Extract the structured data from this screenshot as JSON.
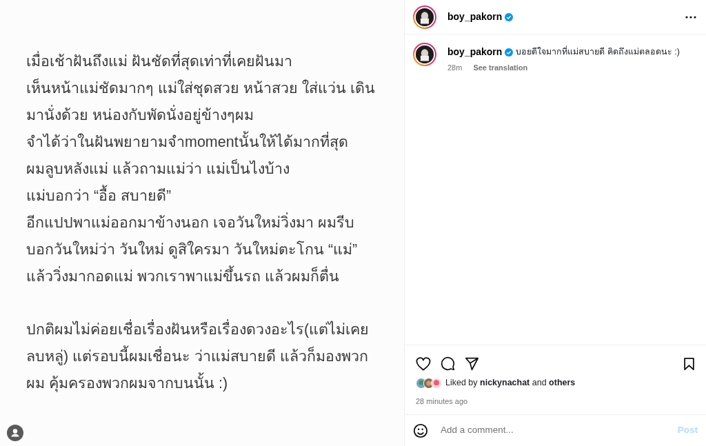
{
  "post_image": {
    "paragraphs": [
      [
        "เมื่อเช้าฝันถึงแม่ ฝันชัดที่สุดเท่าที่เคยฝันมา",
        "เห็นหน้าแม่ชัดมากๆ แม่ใส่ชุดสวย หน้าสวย ใส่แว่น เดิน",
        "มานั่งด้วย หน่องกับพัดนั่งอยู่ข้างๆผม",
        "จำได้ว่าในฝันพยายามจำmomentนั้นให้ได้มากที่สุด",
        "ผมลูบหลังแม่ แล้วถามแม่ว่า แม่เป็นไงบ้าง",
        "แม่บอกว่า “อื้อ สบายดี”",
        "อีกแปปพาแม่ออกมาข้างนอก เจอวันใหม่วิ่งมา ผมรีบ",
        "บอกวันใหม่ว่า วันใหม่ ดูสิใครมา วันใหม่ตะโกน “แม่”",
        "แล้ววิ่งมากอดแม่ พวกเราพาแม่ขึ้นรถ แล้วผมก็ตื่น"
      ],
      [
        "ปกติผมไม่ค่อยเชื่อเรื่องฝันหรือเรื่องดวงอะไร(แต่ไม่เคย",
        "ลบหลู่) แต่รอบนี้ผมเชื่อนะ ว่าแม่สบายดี แล้วก็มองพวก",
        "ผม คุ้มครองพวกผมจากบนนั้น :)"
      ]
    ]
  },
  "header": {
    "username": "boy_pakorn",
    "verified": true
  },
  "caption": {
    "username": "boy_pakorn",
    "verified": true,
    "text": "บอยดีใจมากที่แม่สบายดี คิดถึงแม่ตลอดนะ :)",
    "time": "28m",
    "translate": "See translation"
  },
  "likes": {
    "text": "Liked by **nickynachat** and **others**"
  },
  "time_ago": "28 minutes ago",
  "comment": {
    "placeholder": "Add a comment...",
    "post_button": "Post",
    "post_disabled": true
  }
}
